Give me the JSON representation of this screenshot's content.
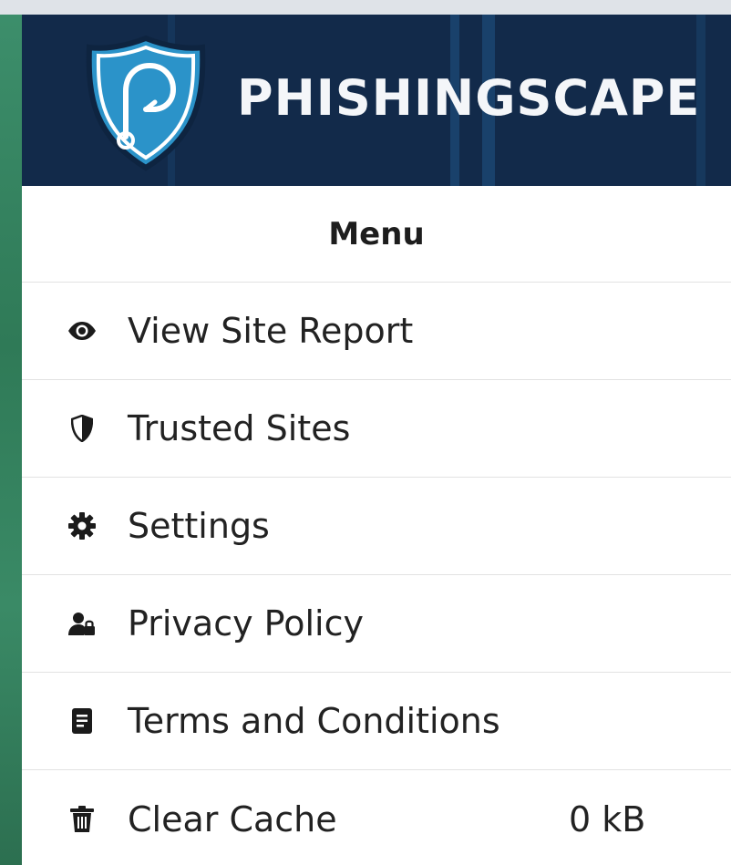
{
  "header": {
    "brand_name": "PHISHINGSCAPE",
    "logo_icon": "shield-hook-icon",
    "colors": {
      "background": "#122a4a",
      "shield": "#2b93c9",
      "shield_border": "#0e2440"
    }
  },
  "menu": {
    "title": "Menu",
    "items": [
      {
        "label": "View Site Report",
        "icon": "eye-icon"
      },
      {
        "label": "Trusted Sites",
        "icon": "half-shield-icon"
      },
      {
        "label": "Settings",
        "icon": "gear-icon"
      },
      {
        "label": "Privacy Policy",
        "icon": "user-lock-icon"
      },
      {
        "label": "Terms and Conditions",
        "icon": "document-icon"
      },
      {
        "label": "Clear Cache",
        "icon": "trash-icon",
        "value": "0 kB"
      }
    ]
  }
}
